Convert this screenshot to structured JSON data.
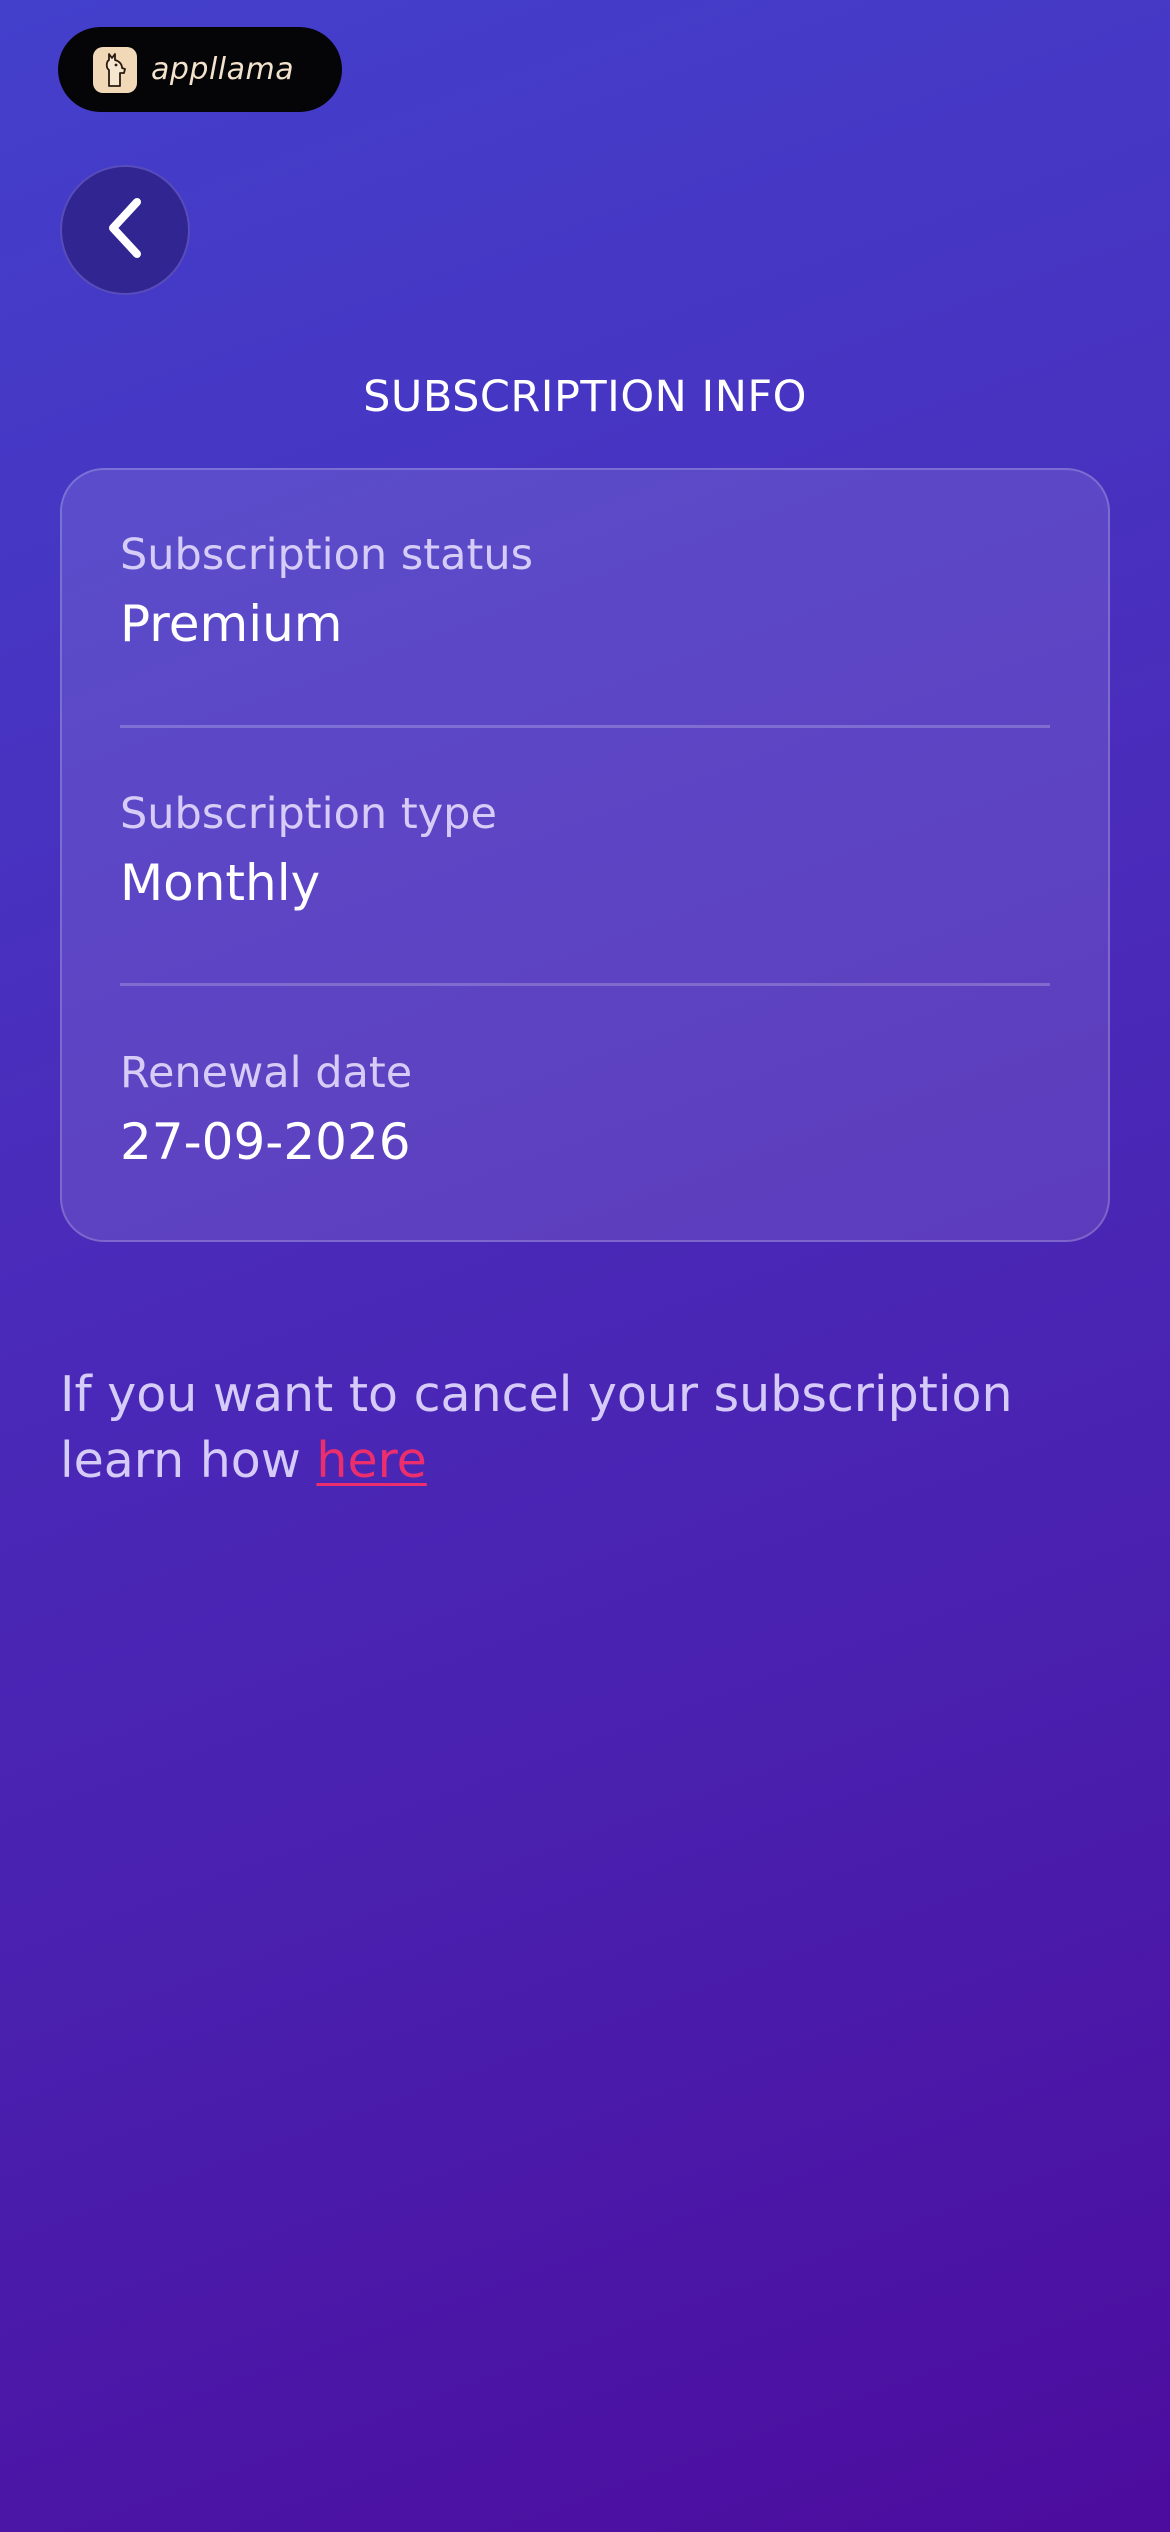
{
  "app": {
    "name": "appllama",
    "logo_icon": "llama-icon",
    "badge_color": "#050407",
    "logo_bg_color": "#f1d9b8"
  },
  "header": {
    "back_icon": "chevron-left-icon",
    "title": "SUBSCRIPTION INFO"
  },
  "subscription": {
    "rows": [
      {
        "label": "Subscription status",
        "value": "Premium"
      },
      {
        "label": "Subscription type",
        "value": "Monthly"
      },
      {
        "label": "Renewal date",
        "value": "27-09-2026"
      }
    ]
  },
  "cancel": {
    "text": "If you want to cancel your subscription learn how",
    "link_label": "here",
    "link_color": "#ec2f6c"
  },
  "theme": {
    "background_start": "#4340cc",
    "background_end": "#4c0c9e"
  }
}
